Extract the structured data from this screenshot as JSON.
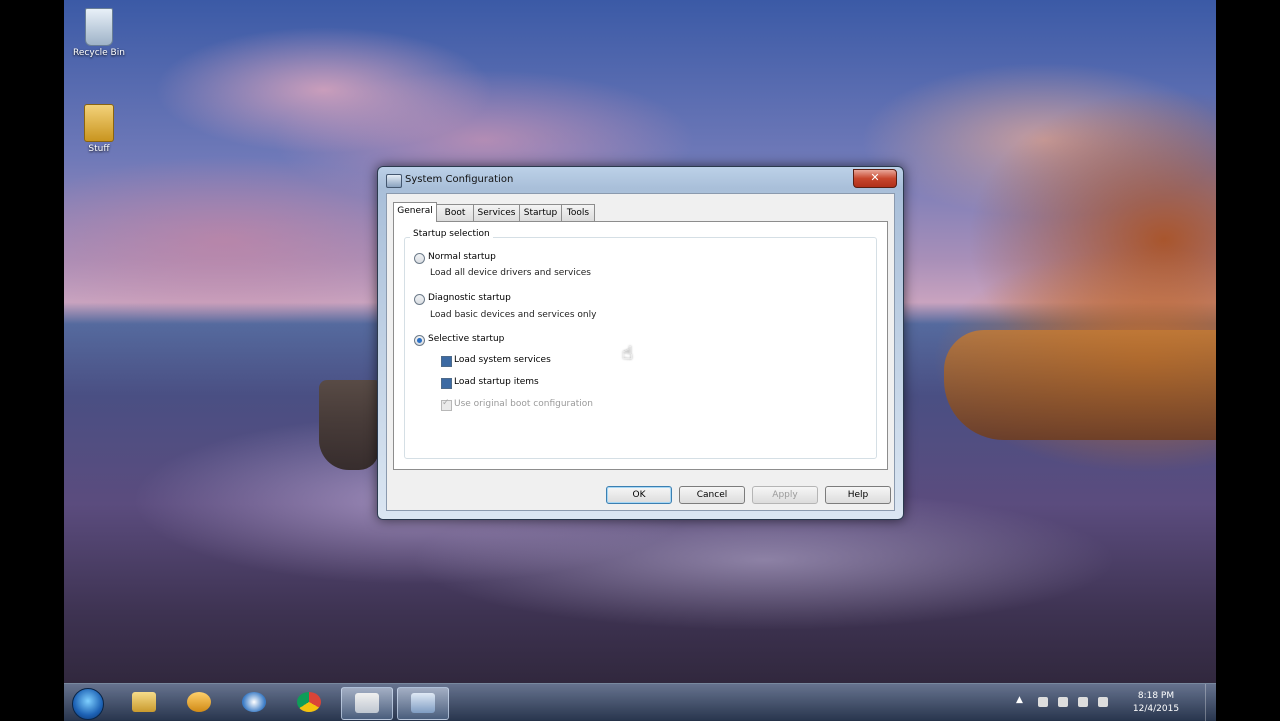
{
  "desktop": {
    "icons": [
      {
        "label": "Recycle Bin",
        "icon": "recycle-bin-icon"
      },
      {
        "label": "Stuff",
        "icon": "folder-icon"
      }
    ]
  },
  "window": {
    "title": "System Configuration",
    "close_label": "✕",
    "tabs": [
      {
        "label": "General",
        "active": true
      },
      {
        "label": "Boot"
      },
      {
        "label": "Services"
      },
      {
        "label": "Startup"
      },
      {
        "label": "Tools"
      }
    ],
    "group_label": "Startup selection",
    "options": {
      "normal": {
        "label": "Normal startup",
        "desc": "Load all device drivers and services",
        "selected": false
      },
      "diagnostic": {
        "label": "Diagnostic startup",
        "desc": "Load basic devices and services only",
        "selected": false
      },
      "selective": {
        "label": "Selective startup",
        "selected": true
      }
    },
    "checkboxes": [
      {
        "label": "Load system services",
        "checked": true,
        "enabled": true
      },
      {
        "label": "Load startup items",
        "checked": true,
        "enabled": true
      },
      {
        "label": "Use original boot configuration",
        "checked": true,
        "enabled": false
      }
    ],
    "buttons": {
      "ok": "OK",
      "cancel": "Cancel",
      "apply": "Apply",
      "help": "Help"
    }
  },
  "taskbar": {
    "items": [
      "start-orb-icon",
      "file-explorer-icon",
      "app-icon",
      "network-app-icon",
      "chrome-icon",
      "window-app-icon",
      "system-configuration-icon"
    ],
    "clock": {
      "time": "8:18 PM",
      "date": "12/4/2015"
    }
  }
}
